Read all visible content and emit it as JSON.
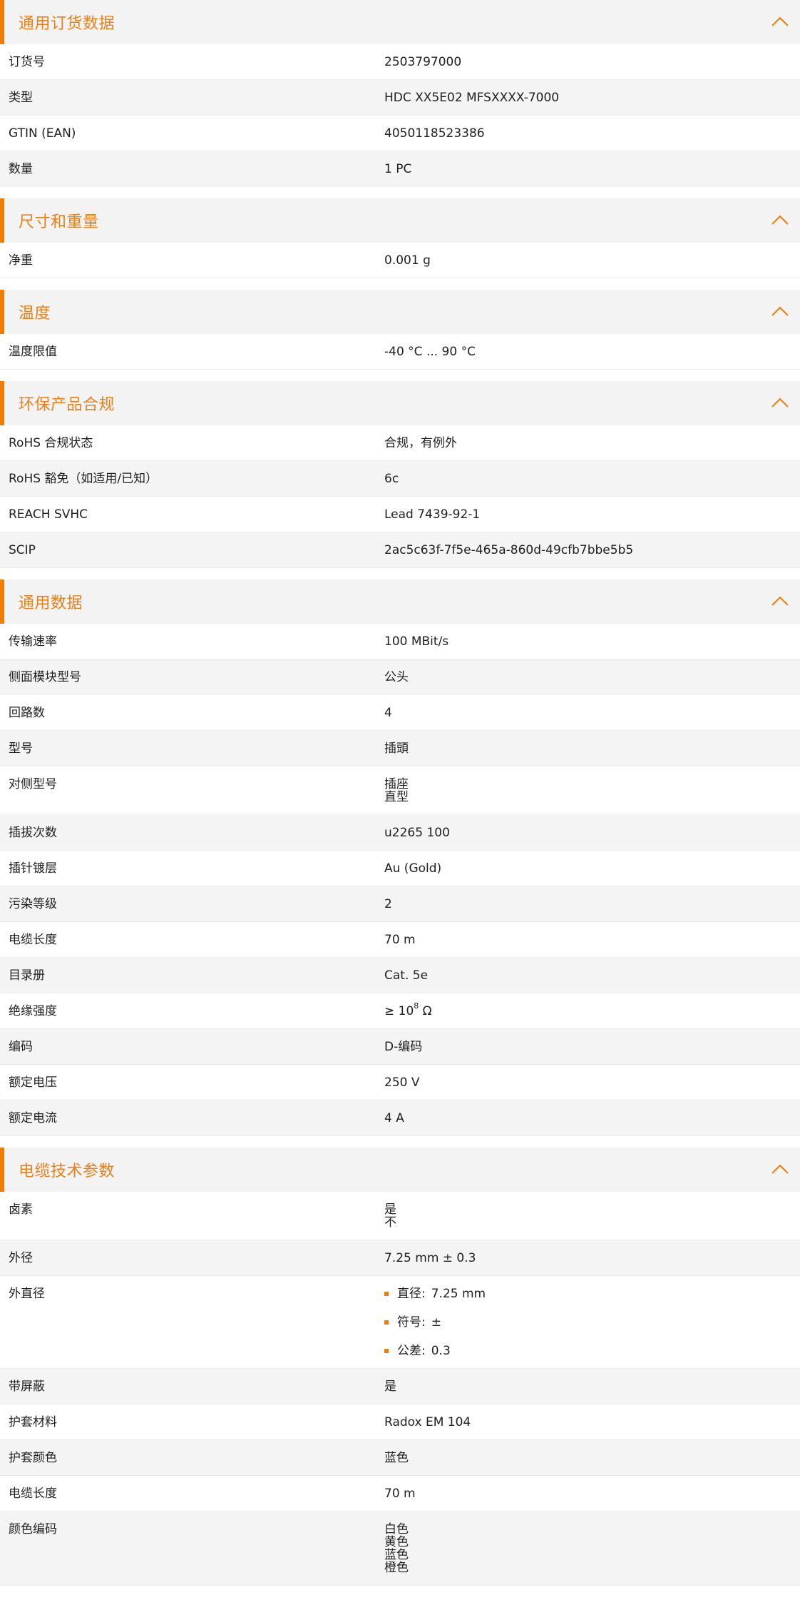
{
  "sections": [
    {
      "title": "通用订货数据",
      "rows": [
        {
          "label": "订货号",
          "value": [
            "2503797000"
          ]
        },
        {
          "label": "类型",
          "value": [
            "HDC XX5E02 MFSXXXX-7000"
          ]
        },
        {
          "label": "GTIN (EAN)",
          "value": [
            "4050118523386"
          ]
        },
        {
          "label": "数量",
          "value": [
            "1  PC"
          ]
        }
      ]
    },
    {
      "title": "尺寸和重量",
      "rows": [
        {
          "label": "净重",
          "value": [
            "0.001  g"
          ]
        }
      ]
    },
    {
      "title": "温度",
      "rows": [
        {
          "label": "温度限值",
          "value": [
            "-40 °C ... 90 °C"
          ]
        }
      ]
    },
    {
      "title": "环保产品合规",
      "rows": [
        {
          "label": "RoHS 合规状态",
          "value": [
            "合规，有例外"
          ]
        },
        {
          "label": "RoHS 豁免（如适用/已知）",
          "value": [
            "6c"
          ]
        },
        {
          "label": "REACH SVHC",
          "value": [
            "Lead 7439-92-1"
          ]
        },
        {
          "label": "SCIP",
          "value": [
            "2ac5c63f-7f5e-465a-860d-49cfb7bbe5b5"
          ]
        }
      ]
    },
    {
      "title": "通用数据",
      "rows": [
        {
          "label": "传输速率",
          "value": [
            "100 MBit/s"
          ]
        },
        {
          "label": "侧面模块型号",
          "value": [
            "公头"
          ]
        },
        {
          "label": "回路数",
          "value": [
            "4"
          ]
        },
        {
          "label": "型号",
          "value": [
            "插頭"
          ]
        },
        {
          "label": "对侧型号",
          "value": [
            "插座",
            "直型"
          ]
        },
        {
          "label": "插拔次数",
          "value": [
            "u2265 100"
          ]
        },
        {
          "label": "插针镀层",
          "value": [
            "Au (Gold)"
          ]
        },
        {
          "label": "污染等级",
          "value": [
            "2"
          ]
        },
        {
          "label": "电缆长度",
          "value": [
            "70  m"
          ]
        },
        {
          "label": "目录册",
          "value": [
            "Cat. 5e"
          ]
        },
        {
          "label": "绝缘强度",
          "value": [
            "≥ 10"
          ],
          "sup": "8",
          "suffix": " Ω"
        },
        {
          "label": "编码",
          "value": [
            "D-编码"
          ]
        },
        {
          "label": "额定电压",
          "value": [
            "250  V"
          ]
        },
        {
          "label": "额定电流",
          "value": [
            "4  A"
          ]
        }
      ]
    },
    {
      "title": "电缆技术参数",
      "rows": [
        {
          "label": "卤素",
          "value": [
            "是",
            "不"
          ]
        },
        {
          "label": "外径",
          "value": [
            "7.25 mm ± 0.3"
          ]
        },
        {
          "label": "外直径",
          "bullets": [
            {
              "name": "直径:",
              "val": "7.25 mm"
            },
            {
              "name": "符号:",
              "val": "±"
            },
            {
              "name": "公差:",
              "val": "0.3"
            }
          ]
        },
        {
          "label": "带屏蔽",
          "value": [
            "是"
          ]
        },
        {
          "label": "护套材料",
          "value": [
            "Radox EM 104"
          ]
        },
        {
          "label": "护套颜色",
          "value": [
            "蓝色"
          ]
        },
        {
          "label": "电缆长度",
          "value": [
            "70  m"
          ]
        },
        {
          "label": "颜色编码",
          "value": [
            "白色",
            "黄色",
            "蓝色",
            "橙色"
          ]
        }
      ]
    }
  ],
  "colors": {
    "accent": "#f07d00",
    "title": "#e8801a",
    "header_bg": "#f3f3f3"
  },
  "icons": {
    "collapse": "chevron-up-icon"
  }
}
